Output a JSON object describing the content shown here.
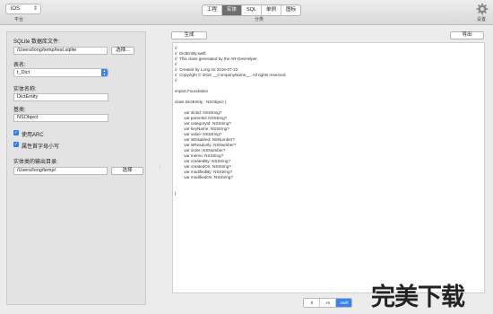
{
  "toolbar": {
    "platform_value": "iOS",
    "platform_label": "平台",
    "tabs": [
      "工程",
      "实体",
      "SQL",
      "单例",
      "图标"
    ],
    "active_tab": "实体",
    "category_label": "分类",
    "settings_label": "设置"
  },
  "left": {
    "sqlite_label": "SQLite 数据库文件:",
    "sqlite_path": "/Users/long/temp/test.sqlite",
    "choose_button": "选择...",
    "table_label": "表名:",
    "table_value": "t_Dict",
    "entity_label": "实体名称:",
    "entity_value": "DictEntity",
    "base_label": "基类:",
    "base_value": "NSObject",
    "use_arc_label": "使用ARC",
    "lowercase_label": "属性首字母小写",
    "output_label": "实体类的输出目录:",
    "output_path": "/Users/long/temp/",
    "output_choose_button": "选择"
  },
  "right": {
    "generate_button": "生成",
    "export_button": "导出",
    "code": "//\n//  DictEntity.swift\n//  This class generated by the AR-DevHelper.\n//\n//  Created by Long on 2016-07-22.\n//  Copyright © 2016 __CompanyName__. All rights reserved.\n//\n\nimport Foundation\n\nclass DictEntity : NSObject {\n\n        var dictId: NSString?\n        var parentId: NSString?\n        var categoryId: NSString?\n        var keyName: NSString?\n        var value: NSString?\n        var isDisabled: NSNumber?\n        var isReadonly: NSNumber?\n        var order: NSNumber?\n        var memo: NSString?\n        var createdBy: NSString?\n        var createdOn: NSString?\n        var modifiedBy: NSString?\n        var modifiedOn: NSString?\n\n\n}",
    "lang_tabs": [
      ".h",
      ".m",
      ".swift"
    ],
    "active_lang": ".swift"
  },
  "watermark": "完美下载",
  "colors": {
    "accent": "#3b82f0",
    "active_tab": "#6e6e6e"
  }
}
